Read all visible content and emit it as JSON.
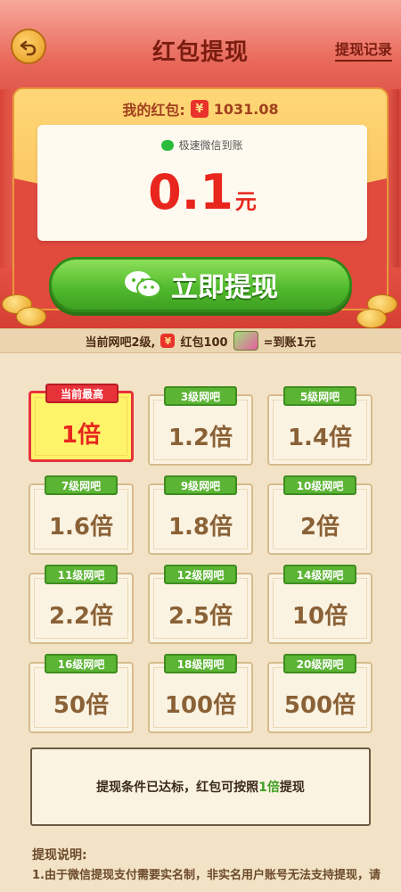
{
  "header": {
    "title": "红包提现",
    "record_link": "提现记录"
  },
  "balance": {
    "label": "我的红包:",
    "currency_symbol": "¥",
    "value": "1031.08"
  },
  "amount_card": {
    "wechat_tag": "极速微信到账",
    "amount": "0.1",
    "unit": "元"
  },
  "withdraw_button": {
    "label": "立即提现"
  },
  "level_bar": {
    "current_level_text": "当前网吧2级,",
    "redpack_text": "红包100",
    "result_text": "=到账1元",
    "currency_symbol": "¥"
  },
  "multipliers": [
    {
      "badge": "当前最高",
      "value": "1倍",
      "active": true
    },
    {
      "badge": "3级网吧",
      "value": "1.2倍",
      "active": false
    },
    {
      "badge": "5级网吧",
      "value": "1.4倍",
      "active": false
    },
    {
      "badge": "7级网吧",
      "value": "1.6倍",
      "active": false
    },
    {
      "badge": "9级网吧",
      "value": "1.8倍",
      "active": false
    },
    {
      "badge": "10级网吧",
      "value": "2倍",
      "active": false
    },
    {
      "badge": "11级网吧",
      "value": "2.2倍",
      "active": false
    },
    {
      "badge": "12级网吧",
      "value": "2.5倍",
      "active": false
    },
    {
      "badge": "14级网吧",
      "value": "10倍",
      "active": false
    },
    {
      "badge": "16级网吧",
      "value": "50倍",
      "active": false
    },
    {
      "badge": "18级网吧",
      "value": "100倍",
      "active": false
    },
    {
      "badge": "20级网吧",
      "value": "500倍",
      "active": false
    }
  ],
  "status": {
    "prefix": "提现条件已达标，红包可按照",
    "highlight": "1倍",
    "suffix": "提现"
  },
  "notes": {
    "title": "提现说明:",
    "line1": "1.由于微信提现支付需要实名制，非实名用户账号无法支持提现，请"
  },
  "colors": {
    "accent_red": "#e8261d",
    "button_green": "#4fb82c",
    "badge_green": "#5bb433",
    "background": "#f3e3c6"
  },
  "icons": [
    "back-arrow-icon",
    "wechat-icon",
    "yuan-icon",
    "ticket-icon"
  ]
}
